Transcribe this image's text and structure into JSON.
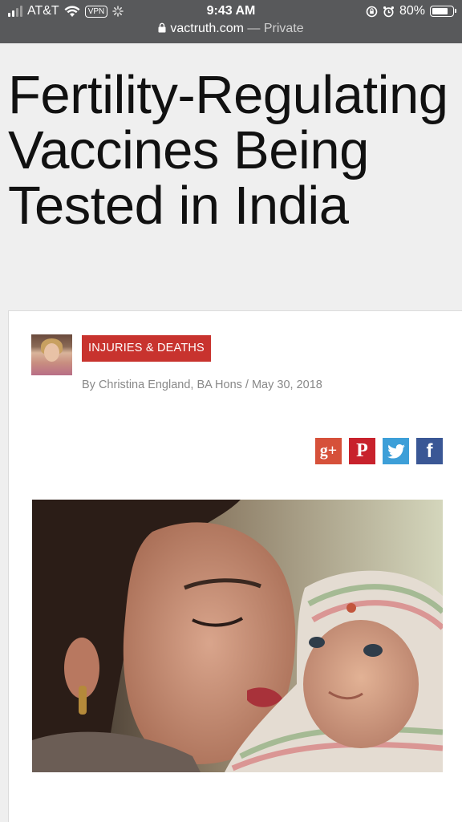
{
  "status_bar": {
    "carrier": "AT&T",
    "vpn": "VPN",
    "time": "9:43 AM",
    "battery": "80%",
    "battery_level": 0.8
  },
  "url_bar": {
    "domain": "vactruth.com",
    "separator": " — ",
    "mode": "Private"
  },
  "article": {
    "title": "Fertility-Regulating Vaccines Being Tested in India",
    "category": "INJURIES & DEATHS",
    "byline": "By Christina England, BA Hons / May 30, 2018"
  },
  "share": {
    "gplus": "g+",
    "pinterest": "P",
    "facebook": "f"
  },
  "colors": {
    "category_bg": "#c8332e",
    "gplus": "#d6513a",
    "pinterest": "#c8222c",
    "twitter": "#3d9fd8",
    "facebook": "#3a5795"
  }
}
